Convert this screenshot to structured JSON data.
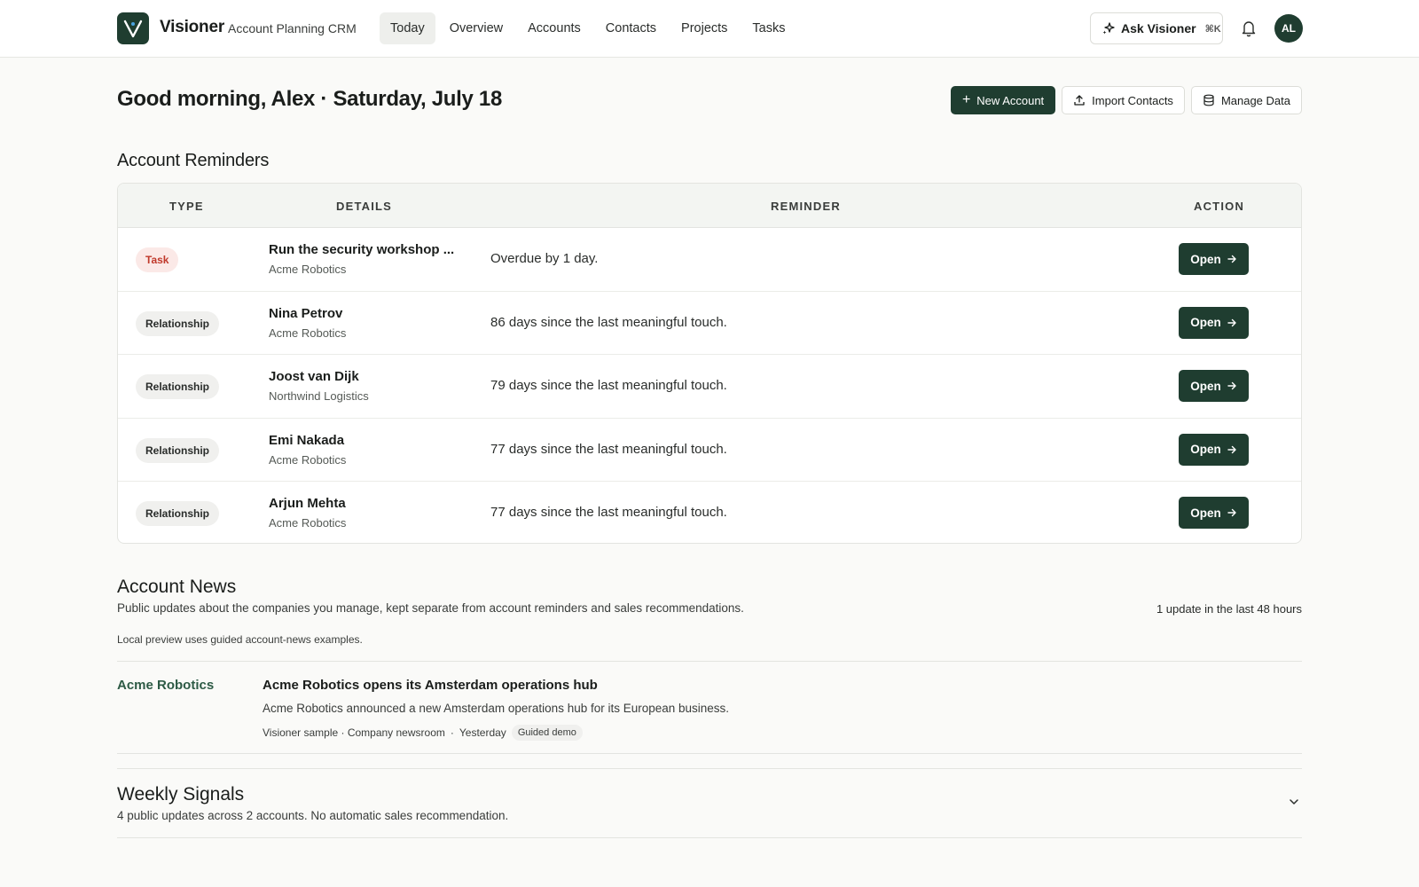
{
  "app": {
    "name": "Visioner",
    "subtitle": "Account Planning CRM"
  },
  "nav": {
    "items": [
      {
        "label": "Today",
        "active": true
      },
      {
        "label": "Overview"
      },
      {
        "label": "Accounts"
      },
      {
        "label": "Contacts"
      },
      {
        "label": "Projects"
      },
      {
        "label": "Tasks"
      }
    ]
  },
  "header": {
    "ask_label": "Ask Visioner",
    "ask_shortcut": "⌘K",
    "avatar_initials": "AL",
    "greeting": "Good morning, Alex · Saturday, July 18",
    "new_account": "New Account",
    "import_contacts": "Import Contacts",
    "manage_data": "Manage Data"
  },
  "reminders": {
    "title": "Account Reminders",
    "columns": [
      "TYPE",
      "DETAILS",
      "REMINDER",
      "ACTION"
    ],
    "rows": [
      {
        "type": "Task",
        "kind": "task",
        "name": "Run the security workshop ...",
        "company": "Acme Robotics",
        "reminder": "Overdue by 1 day.",
        "action": "Open"
      },
      {
        "type": "Relationship",
        "kind": "rel",
        "name": "Nina Petrov",
        "company": "Acme Robotics",
        "reminder": "86 days since the last meaningful touch.",
        "action": "Open"
      },
      {
        "type": "Relationship",
        "kind": "rel",
        "name": "Joost van Dijk",
        "company": "Northwind Logistics",
        "reminder": "79 days since the last meaningful touch.",
        "action": "Open"
      },
      {
        "type": "Relationship",
        "kind": "rel",
        "name": "Emi Nakada",
        "company": "Acme Robotics",
        "reminder": "77 days since the last meaningful touch.",
        "action": "Open"
      },
      {
        "type": "Relationship",
        "kind": "rel",
        "name": "Arjun Mehta",
        "company": "Acme Robotics",
        "reminder": "77 days since the last meaningful touch.",
        "action": "Open"
      }
    ]
  },
  "news": {
    "title": "Account News",
    "description": "Public updates about the companies you manage, kept separate from account reminders and sales recommendations.",
    "count": "1 update in the last 48 hours",
    "note": "Local preview uses guided account-news examples.",
    "items": [
      {
        "company": "Acme Robotics",
        "headline": "Acme Robotics opens its Amsterdam operations hub",
        "body": "Acme Robotics announced a new Amsterdam operations hub for its European business.",
        "source": "Visioner sample · Company newsroom",
        "sep": "·",
        "when": "Yesterday",
        "tag": "Guided demo"
      }
    ]
  },
  "weekly": {
    "title": "Weekly Signals",
    "description": "4 public updates across 2 accounts. No automatic sales recommendation."
  },
  "colors": {
    "brand": "#1f3d30",
    "task": "#c0392b",
    "link": "#2d5a45"
  }
}
